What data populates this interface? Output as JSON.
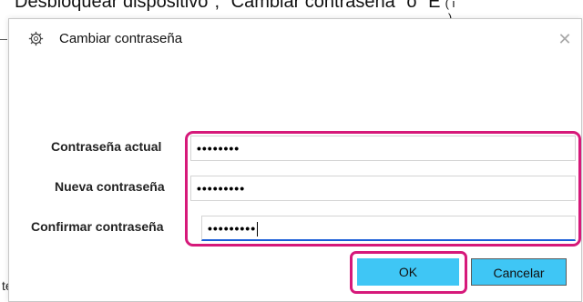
{
  "background": {
    "heading": "Desbloquear dispositivo\", \"Cambiar contraseña\" o \"E",
    "circle_glyph": "( i )",
    "fragment": "te"
  },
  "dialog": {
    "title": "Cambiar contraseña",
    "icon": "gear-settings-icon",
    "close_glyph": "✕",
    "fields": [
      {
        "label": "Contraseña actual",
        "value": "••••••••"
      },
      {
        "label": "Nueva contraseña",
        "value": "•••••••••"
      },
      {
        "label": "Confirmar contraseña",
        "value": "•••••••••"
      }
    ],
    "ok_label": "OK",
    "cancel_label": "Cancelar"
  },
  "colors": {
    "highlight": "#d6197a",
    "button": "#3fc6f5",
    "focus_underline": "#1a5dd8"
  }
}
